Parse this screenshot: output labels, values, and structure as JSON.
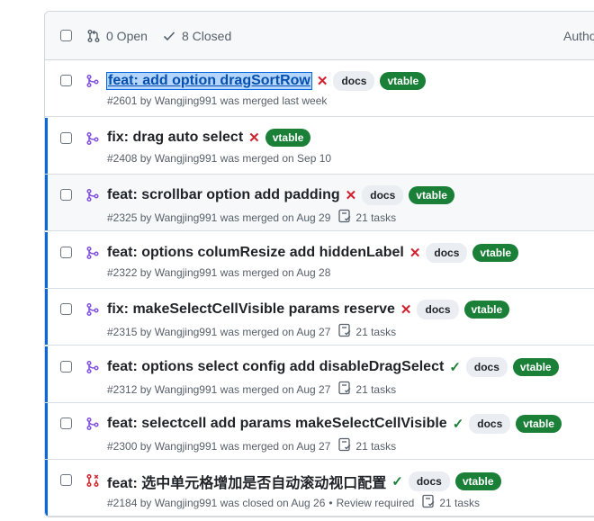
{
  "header": {
    "open_label": "0 Open",
    "closed_label": "8 Closed",
    "author_label": "Autho"
  },
  "prs": [
    {
      "title": "feat: add option dragSortRow",
      "status": "fail",
      "labels": [
        "docs",
        "vtable"
      ],
      "number": "#2601",
      "author": "Wangjing991",
      "meta": "#2601 by Wangjing991 was merged last week",
      "tasks": "",
      "state": "merged"
    },
    {
      "title": "fix: drag auto select",
      "status": "fail",
      "labels": [
        "vtable"
      ],
      "number": "#2408",
      "author": "Wangjing991",
      "meta": "#2408 by Wangjing991 was merged on Sep 10",
      "tasks": "",
      "state": "merged"
    },
    {
      "title": "feat: scrollbar option add padding",
      "status": "fail",
      "labels": [
        "docs",
        "vtable"
      ],
      "number": "#2325",
      "author": "Wangjing991",
      "meta": "#2325 by Wangjing991 was merged on Aug 29",
      "tasks": "21 tasks",
      "state": "merged"
    },
    {
      "title": "feat: options columResize add hiddenLabel",
      "status": "fail",
      "labels": [
        "docs",
        "vtable"
      ],
      "number": "#2322",
      "author": "Wangjing991",
      "meta": "#2322 by Wangjing991 was merged on Aug 28",
      "tasks": "",
      "state": "merged"
    },
    {
      "title": "fix: makeSelectCellVisible params reserve",
      "status": "fail",
      "labels": [
        "docs",
        "vtable"
      ],
      "number": "#2315",
      "author": "Wangjing991",
      "meta": "#2315 by Wangjing991 was merged on Aug 27",
      "tasks": "21 tasks",
      "state": "merged"
    },
    {
      "title": "feat: options select config add disableDragSelect",
      "status": "pass",
      "labels": [
        "docs",
        "vtable"
      ],
      "number": "#2312",
      "author": "Wangjing991",
      "meta": "#2312 by Wangjing991 was merged on Aug 27",
      "tasks": "21 tasks",
      "state": "merged"
    },
    {
      "title": "feat: selectcell add params makeSelectCellVisible",
      "status": "pass",
      "labels": [
        "docs",
        "vtable"
      ],
      "number": "#2300",
      "author": "Wangjing991",
      "meta": "#2300 by Wangjing991 was merged on Aug 27",
      "tasks": "21 tasks",
      "state": "merged"
    },
    {
      "title": "feat: 选中单元格增加是否自动滚动视口配置",
      "status": "pass",
      "labels": [
        "docs",
        "vtable"
      ],
      "number": "#2184",
      "author": "Wangjing991",
      "meta": "#2184 by Wangjing991 was closed on Aug 26",
      "review": "Review required",
      "tasks": "21 tasks",
      "state": "closed"
    }
  ],
  "icons": {
    "status_fail": "✕",
    "status_pass": "✓",
    "merged_color": "#8250df",
    "closed_color": "#cf222e"
  }
}
